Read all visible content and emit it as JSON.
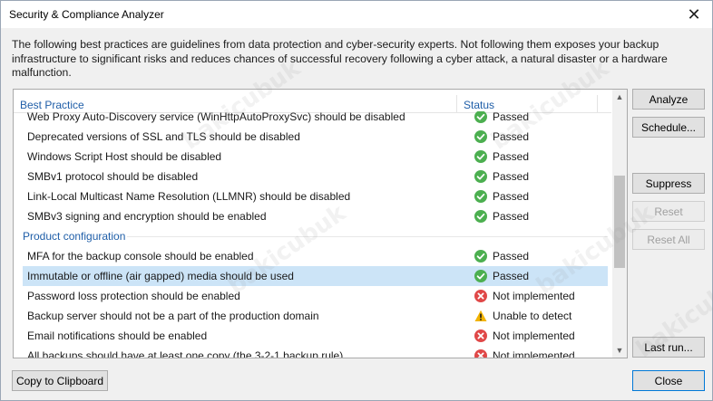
{
  "window": {
    "title": "Security & Compliance Analyzer",
    "close_glyph": "✕"
  },
  "description": "The following best practices are guidelines from data protection and cyber-security experts. Not following them exposes your backup infrastructure to significant risks and reduces chances of successful recovery following a cyber attack, a natural disaster or a hardware malfunction.",
  "list": {
    "col_practice": "Best Practice",
    "col_status": "Status",
    "rows": [
      {
        "type": "item",
        "name": "Web Proxy Auto-Discovery service (WinHttpAutoProxySvc) should be disabled",
        "status": "Passed",
        "icon": "passed-icon"
      },
      {
        "type": "item",
        "name": "Deprecated versions of SSL and TLS should be disabled",
        "status": "Passed",
        "icon": "passed-icon"
      },
      {
        "type": "item",
        "name": "Windows Script Host should be disabled",
        "status": "Passed",
        "icon": "passed-icon"
      },
      {
        "type": "item",
        "name": "SMBv1 protocol should be disabled",
        "status": "Passed",
        "icon": "passed-icon"
      },
      {
        "type": "item",
        "name": "Link-Local Multicast Name Resolution (LLMNR) should be disabled",
        "status": "Passed",
        "icon": "passed-icon"
      },
      {
        "type": "item",
        "name": "SMBv3 signing and encryption should be enabled",
        "status": "Passed",
        "icon": "passed-icon"
      },
      {
        "type": "group",
        "name": "Product configuration"
      },
      {
        "type": "item",
        "name": "MFA for the backup console should be enabled",
        "status": "Passed",
        "icon": "passed-icon"
      },
      {
        "type": "item",
        "name": "Immutable or offline (air gapped) media should be used",
        "status": "Passed",
        "icon": "passed-icon",
        "selected": true
      },
      {
        "type": "item",
        "name": "Password loss protection should be enabled",
        "status": "Not implemented",
        "icon": "not-implemented-icon"
      },
      {
        "type": "item",
        "name": "Backup server should not be a part of the production domain",
        "status": "Unable to detect",
        "icon": "warning-icon"
      },
      {
        "type": "item",
        "name": "Email notifications should be enabled",
        "status": "Not implemented",
        "icon": "not-implemented-icon"
      },
      {
        "type": "item",
        "name": "All backups should have at least one copy (the 3-2-1 backup rule)",
        "status": "Not implemented",
        "icon": "not-implemented-icon"
      }
    ]
  },
  "buttons": {
    "analyze": "Analyze",
    "schedule": "Schedule...",
    "suppress": "Suppress",
    "reset": "Reset",
    "reset_all": "Reset All",
    "last_run": "Last run...",
    "copy": "Copy to Clipboard",
    "close": "Close"
  },
  "watermark_text": "bakicubuk",
  "colors": {
    "header_blue": "#1f5ea8",
    "passed_green": "#4caf50",
    "error_red": "#e04848",
    "warning_yellow": "#f2b300",
    "selection": "#cce4f7"
  }
}
